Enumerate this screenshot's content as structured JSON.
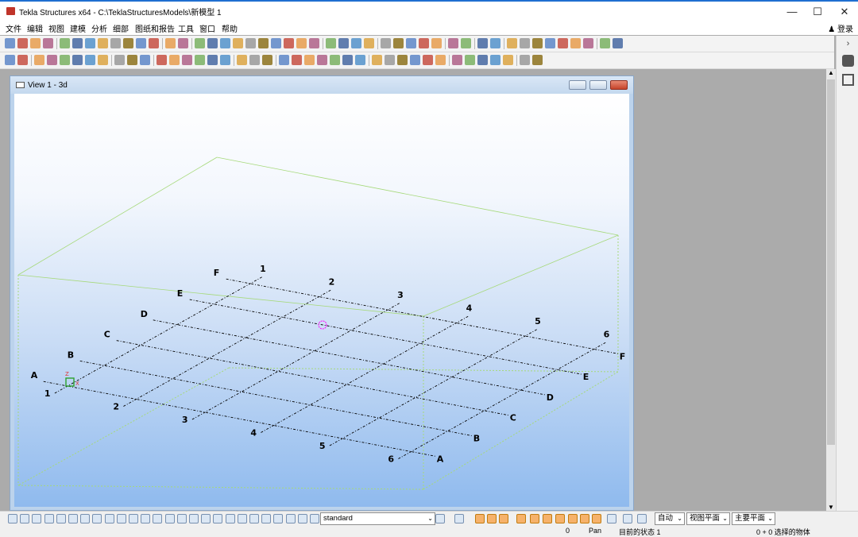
{
  "window": {
    "title": "Tekla Structures x64 - C:\\TeklaStructuresModels\\新模型 1",
    "controls": {
      "minimize": "—",
      "maximize": "☐",
      "close": "✕"
    }
  },
  "menu": {
    "items": [
      "文件",
      "编辑",
      "视图",
      "建模",
      "分析",
      "细部",
      "图纸和报告",
      "工具",
      "窗口",
      "帮助"
    ],
    "login": "登录"
  },
  "side_panel": {
    "expand": "›"
  },
  "view": {
    "title": "View 1 - 3d",
    "grid": {
      "numbers": [
        "1",
        "2",
        "3",
        "4",
        "5",
        "6"
      ],
      "letters": [
        "A",
        "B",
        "C",
        "D",
        "E",
        "F"
      ]
    },
    "axis_labels": {
      "z": "Z",
      "x": "X"
    }
  },
  "bottom_toolbar": {
    "selection_filter": "standard",
    "auto_select": "自动",
    "view_plane": "视图平面",
    "work_plane": "主要平面"
  },
  "status": {
    "count": "0",
    "mode": "Pan",
    "state": "目前的状态 1",
    "selected": "0 + 0 选择的物体"
  },
  "colors": {
    "title_accent": "#1f6fd0",
    "workspace": "#ababab",
    "grid_line": "#000000",
    "bounding_box": "#a6d97a",
    "work_point": "#ff00ff"
  }
}
